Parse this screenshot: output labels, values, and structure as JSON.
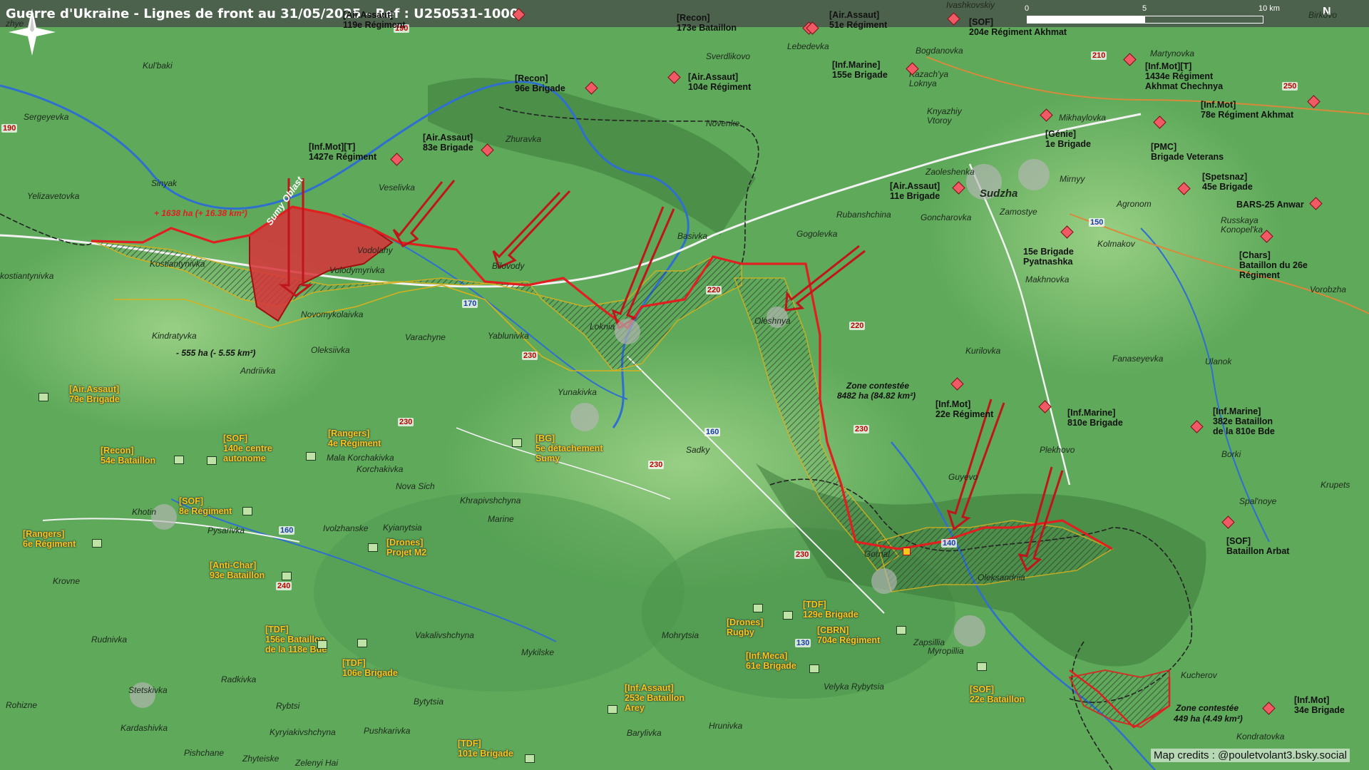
{
  "title": "Guerre d'Ukraine - Lignes de front au 31/05/2025 - Ref : U250531-1000",
  "scale": {
    "zero": "0",
    "mid": "5",
    "end": "10 km"
  },
  "north": "N",
  "credits": "Map credits : @pouletvolant3.bsky.social",
  "colors": {
    "ru_zone": "#d8333a",
    "front_line": "#e02020",
    "ua_label": "#f7c71b",
    "contested": "#555555"
  },
  "annotations": {
    "gain": "+ 1638 ha (+ 16.38 km²)",
    "loss": "- 555 ha (- 5.55 km²)",
    "sumy_oblast": "Sumy Oblast",
    "zone_title": "Zone contestée",
    "zone1_area": "8482 ha (84.82 km²)",
    "zone2_area": "449 ha (4.49 km²)"
  },
  "towns": {
    "sudzha": "Sudzha"
  },
  "places": {
    "yelizavetovka": "Yelizavetovka",
    "sergeyevka": "Sergeyevka",
    "kulbaki": "Kul'baki",
    "sinyak": "Sinyak",
    "kostiantynivka": "Kostiantynivka",
    "kostiantynivka2": "kostiantynivka",
    "kindratyvka": "Kindratyvka",
    "oleksiivka": "Oleksiivka",
    "andriivka": "Andriivka",
    "novomykolaivka": "Novomykolaivka",
    "volodymyrivka": "Volodymyrivka",
    "vodolahy": "Vodolahy",
    "veselivka": "Veselivka",
    "zhuravka": "Zhuravka",
    "bilovody": "Bilovody",
    "varachyne": "Varachyne",
    "yablunivka": "Yablunivka",
    "loknia": "Loknia",
    "yunakivka": "Yunakivka",
    "basivka": "Basivka",
    "novenke": "Novenke",
    "oleshnya": "Oleshnya",
    "gogolevka": "Gogolevka",
    "rubanshchina": "Rubanshchina",
    "goncharovka": "Goncharovka",
    "zaoleshenka": "Zaoleshenka",
    "zamostye": "Zamostye",
    "mirnyy": "Mirnyy",
    "agronom": "Agronom",
    "kolmakov": "Kolmakov",
    "makhnovka": "Makhnovka",
    "kurilovka": "Kurilovka",
    "fanaseyevka": "Fanaseyevka",
    "ulanok": "Ulanok",
    "plekhovo": "Plekhovo",
    "guyevo": "Guyevo",
    "gornal": "Gornal",
    "oleksandriia": "Oleksandriia",
    "sadky": "Sadky",
    "nova_sich": "Nova Sich",
    "khrapivshchyna": "Khrapivshchyna",
    "marine": "Marine",
    "korchakivka": "Korchakivka",
    "mala_korchakivka": "Mala Korchakivka",
    "khotin": "Khotin",
    "pysarivka": "Pysarivka",
    "ivolzhanske": "Ivolzhanske",
    "kyianytsia": "Kyianytsia",
    "krovne": "Krovne",
    "rudnivka": "Rudnivka",
    "radkivka": "Radkivka",
    "stetskivka": "Stetskivka",
    "kardashivka": "Kardashivka",
    "rohizne": "Rohizne",
    "rybtsi": "Rybtsi",
    "kyryiakivshchyna": "Kyryiakivshchyna",
    "pushkarivka": "Pushkarivka",
    "bytytsia": "Bytytsia",
    "pishchane": "Pishchane",
    "zhyteiske": "Zhyteiske",
    "zelenyi_hai": "Zelenyi Hai",
    "vakalivshchyna": "Vakalivshchyna",
    "mykilske": "Mykilske",
    "mohrytsia": "Mohrytsia",
    "barylivka": "Barylivka",
    "hrunivka": "Hrunivka",
    "velyka_rybytsia": "Velyka Rybytsia",
    "zapsillia": "Zapsillia",
    "myropillia": "Myropillia",
    "kucherov": "Kucherov",
    "kondratovka": "Kondratovka",
    "sverdlikovo": "Sverdlikovo",
    "lebedevka": "Lebedevka",
    "bogdanovka": "Bogdanovka",
    "kazachya_loknya": "Kazach'ya\nLoknya",
    "knyazhiy_vtoroy": "Knyazhiy\nVtoroy",
    "martynovka": "Martynovka",
    "mikhaylovka": "Mikhaylovka",
    "russkaya_konopelka": "Russkaya\nKonopel'ka",
    "vorobzha": "Vorobzha",
    "borki": "Borki",
    "krupets": "Krupets",
    "spalnoye": "Spal'noye",
    "ivashkovskiy": "Ivashkovskiy",
    "birkovo": "Birkovo",
    "zhye": "zhye"
  },
  "roads": {
    "r190a": "190",
    "r190b": "190",
    "r210": "210",
    "r250": "250",
    "r150": "150",
    "r170": "170",
    "r230a": "230",
    "r230b": "230",
    "r230c": "230",
    "r230d": "230",
    "r230e": "230",
    "r220a": "220",
    "r220b": "220",
    "r160a": "160",
    "r160b": "160",
    "r140": "140",
    "r130": "130",
    "r240": "240"
  },
  "units_ru": [
    {
      "id": "u1",
      "text": "[Air.Assaut]\n119e Régiment"
    },
    {
      "id": "u2",
      "text": "[Recon]\n173e Bataillon"
    },
    {
      "id": "u3",
      "text": "[Air.Assaut]\n51e Régiment"
    },
    {
      "id": "u4",
      "text": "[SOF]\n204e Régiment Akhmat"
    },
    {
      "id": "u5",
      "text": "[Recon]\n96e Brigade"
    },
    {
      "id": "u6",
      "text": "[Air.Assaut]\n104e Régiment"
    },
    {
      "id": "u7",
      "text": "[Inf.Marine]\n155e Brigade"
    },
    {
      "id": "u8",
      "text": "[Inf.Mot][T]\n1434e Régiment\nAkhmat Chechnya"
    },
    {
      "id": "u9",
      "text": "[Inf.Mot]\n78e Régiment Akhmat"
    },
    {
      "id": "u10",
      "text": "[Inf.Mot][T]\n1427e Régiment"
    },
    {
      "id": "u11",
      "text": "[Air.Assaut]\n83e Brigade"
    },
    {
      "id": "u12",
      "text": "[Génie]\n1e Brigade"
    },
    {
      "id": "u13",
      "text": "[PMC]\nBrigade Veterans"
    },
    {
      "id": "u14",
      "text": "[Air.Assaut]\n11e Brigade"
    },
    {
      "id": "u15",
      "text": "[Spetsnaz]\n45e Brigade"
    },
    {
      "id": "u16",
      "text": "BARS-25 Anwar"
    },
    {
      "id": "u17",
      "text": "15e Brigade\nPyatnashka"
    },
    {
      "id": "u18",
      "text": "[Chars]\nBataillon du 26e\nRégiment"
    },
    {
      "id": "u19",
      "text": "[Inf.Mot]\n22e Régiment"
    },
    {
      "id": "u20",
      "text": "[Inf.Marine]\n810e Brigade"
    },
    {
      "id": "u21",
      "text": "[Inf.Marine]\n382e Bataillon\nde la 810e Bde"
    },
    {
      "id": "u22",
      "text": "[SOF]\nBataillon Arbat"
    },
    {
      "id": "u23",
      "text": "[Inf.Mot]\n34e Brigade"
    }
  ],
  "units_ua": [
    {
      "id": "a1",
      "text": "[Air.Assaut]\n79e Brigade"
    },
    {
      "id": "a2",
      "text": "[Recon]\n54e Bataillon"
    },
    {
      "id": "a3",
      "text": "[SOF]\n140e centre\nautonome"
    },
    {
      "id": "a4",
      "text": "[Rangers]\n4e Régiment"
    },
    {
      "id": "a5",
      "text": "[BG]\n5e détachement\nSumy"
    },
    {
      "id": "a6",
      "text": "[SOF]\n8e Régiment"
    },
    {
      "id": "a7",
      "text": "[Rangers]\n6e Régiment"
    },
    {
      "id": "a8",
      "text": "[Drones]\nProjet M2"
    },
    {
      "id": "a9",
      "text": "[Anti-Char]\n93e Bataillon"
    },
    {
      "id": "a10",
      "text": "[TDF]\n156e Bataillon\nde la 118e Bde"
    },
    {
      "id": "a11",
      "text": "[TDF]\n106e Brigade"
    },
    {
      "id": "a12",
      "text": "[Drones]\nRugby"
    },
    {
      "id": "a13",
      "text": "[TDF]\n129e Brigade"
    },
    {
      "id": "a14",
      "text": "[CBRN]\n704e Régiment"
    },
    {
      "id": "a15",
      "text": "[Inf.Meca]\n61e Brigade"
    },
    {
      "id": "a16",
      "text": "[Inf.Assaut]\n253e Bataillon\nArey"
    },
    {
      "id": "a17",
      "text": "[SOF]\n22e Bataillon"
    },
    {
      "id": "a18",
      "text": "[TDF]\n101e Brigade"
    }
  ]
}
